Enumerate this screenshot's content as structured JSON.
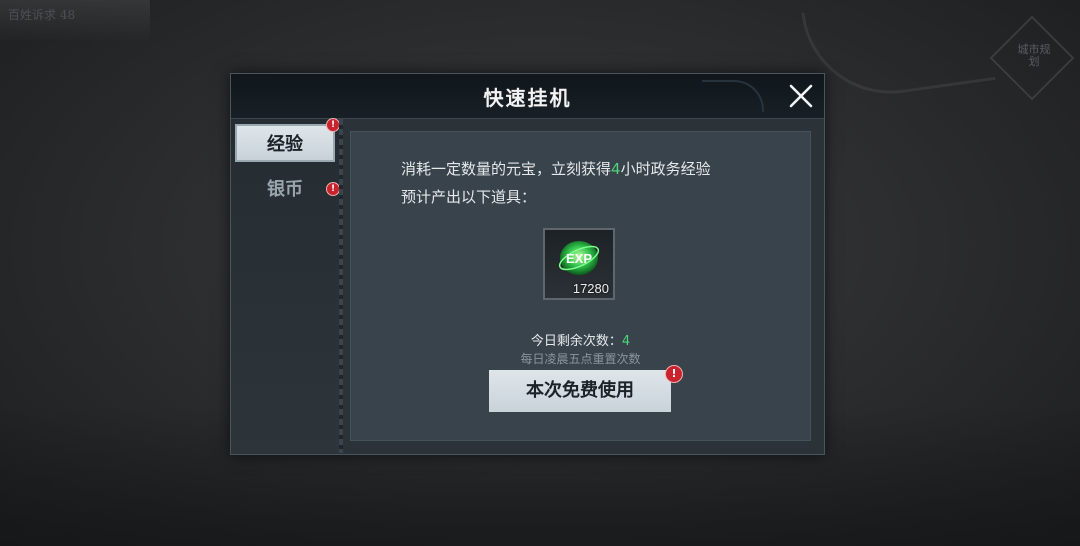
{
  "background": {
    "top_left_label": "百姓诉求 48",
    "seal_text": "城市规划"
  },
  "dialog": {
    "title": "快速挂机",
    "close_icon": "close-icon",
    "tabs": [
      {
        "label": "经验",
        "selected": true,
        "has_alert": true
      },
      {
        "label": "银币",
        "selected": false,
        "has_alert": true
      }
    ],
    "alert_mark": "!",
    "description": {
      "line1_prefix": "消耗一定数量的元宝，立刻获得",
      "line1_highlight": "4",
      "line1_suffix": "小时政务经验",
      "line2": "预计产出以下道具："
    },
    "item": {
      "icon": "exp-orb-icon",
      "icon_label": "EXP",
      "count": "17280"
    },
    "remaining_label": "今日剩余次数：",
    "remaining_value": "4",
    "reset_note": "每日凌晨五点重置次数",
    "use_button_label": "本次免费使用",
    "colors": {
      "accent_green": "#4fd47a",
      "alert_red": "#c9232d"
    }
  }
}
